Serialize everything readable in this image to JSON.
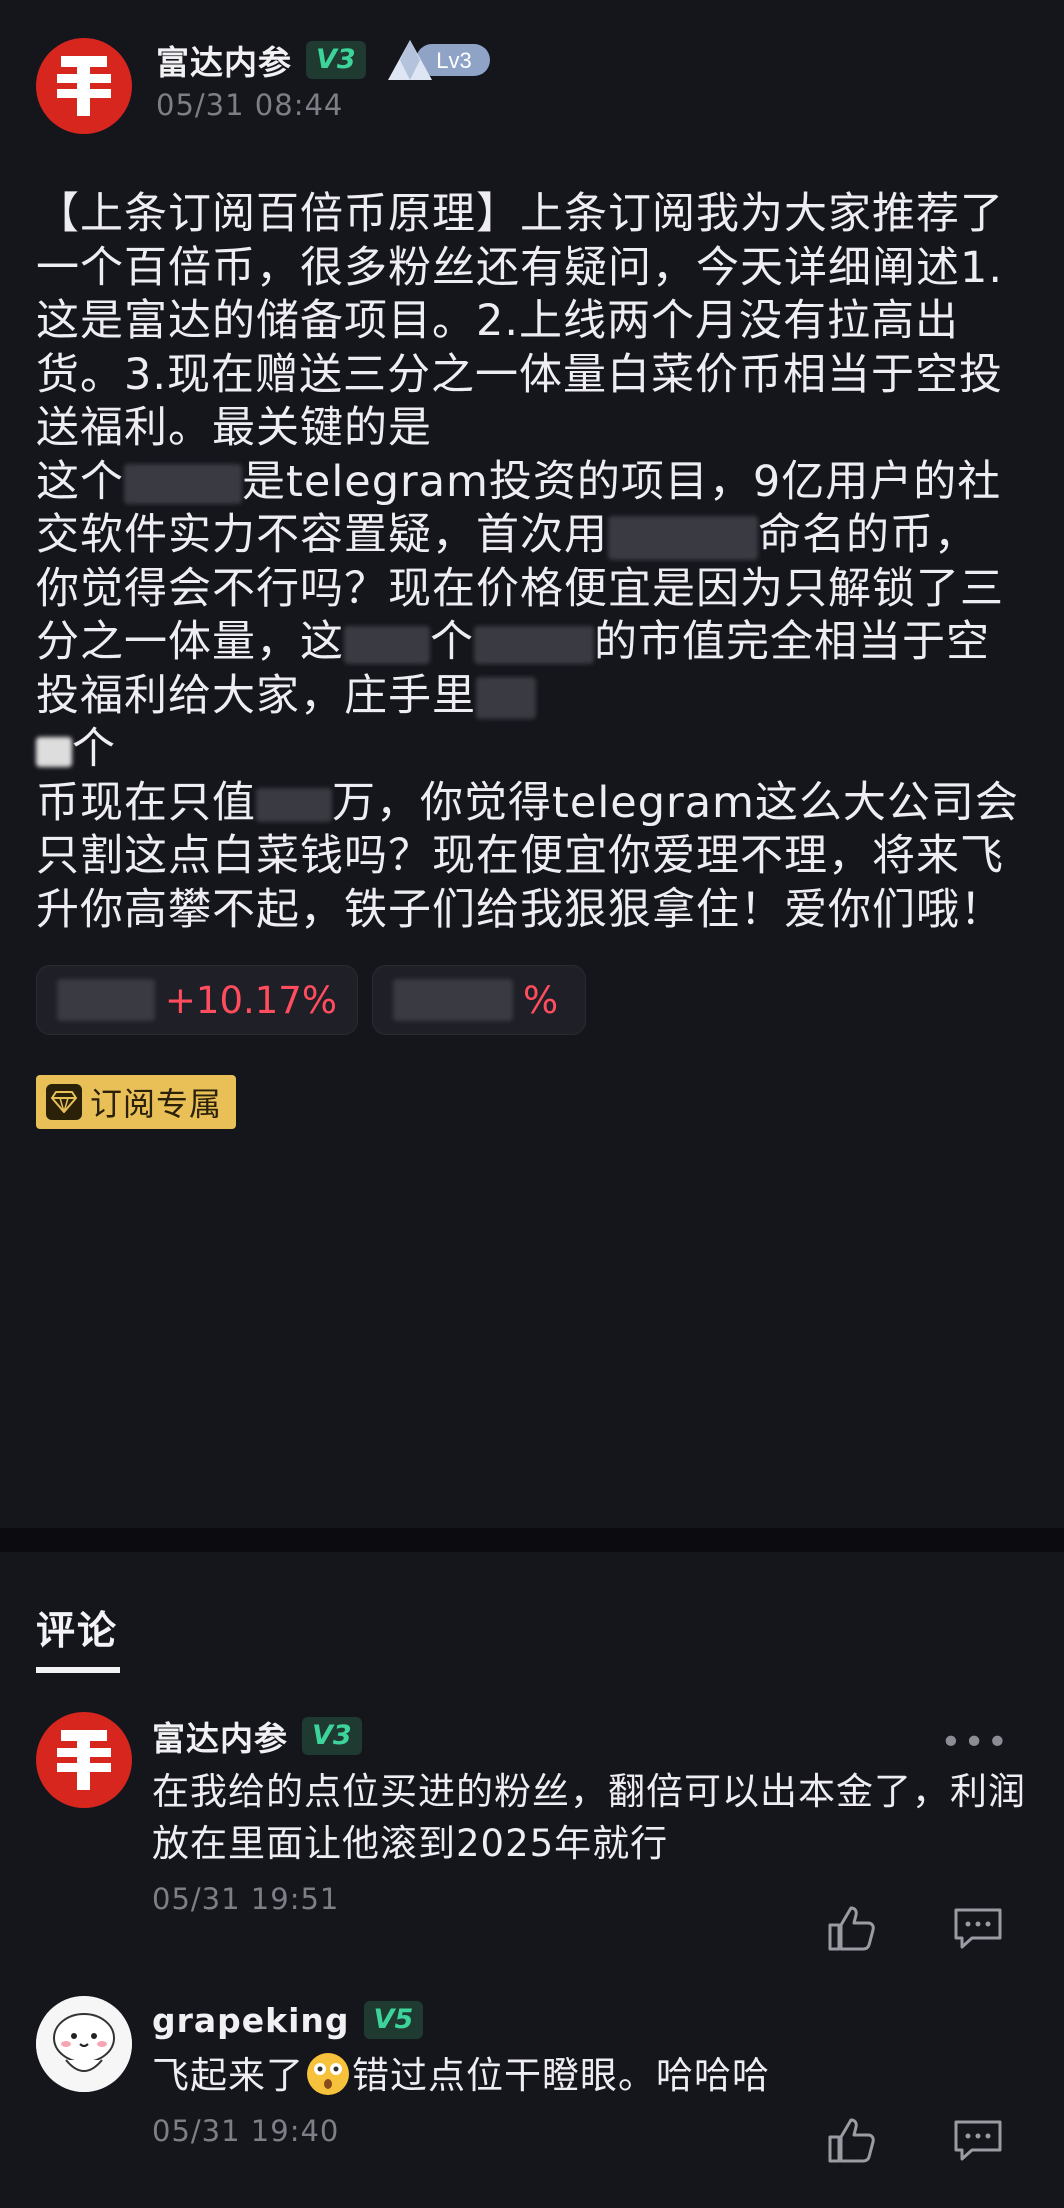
{
  "post": {
    "author": "富达内参",
    "vip_badge": "V3",
    "level_badge": "Lv3",
    "timestamp": "05/31 08:44",
    "content_1": "【上条订阅百倍币原理】上条订阅我为大家推荐了一个百倍币，很多粉丝还有疑问，今天详细阐述1.这是富达的储备项目。2.上线两个月没有拉高出货。3.现在赠送三分之一体量白菜价币相当于空投送福利。最关键的是",
    "content_2a": "这个",
    "content_2b": "是telegram投资的项目，9亿用户的社交软件实力不容置疑，首次用",
    "content_3a": "命名的币，你觉得会不行吗？现在价格便宜是因为只解锁了三分之一体量，这",
    "content_3b": "个",
    "content_3c": "的市值完全相当于空投福利给大家，庄手里",
    "content_4": "个",
    "content_5a": "币现在只值",
    "content_5b": "万，你觉得telegram这么大公司会只割这点白菜钱吗？现在便宜你爱理不理，将来飞升你高攀不起，铁子们给我狠狠拿住！爱你们哦！",
    "stocks": [
      {
        "change": "+10.17%"
      },
      {
        "change": "%"
      }
    ],
    "subscription_tag": "订阅专属"
  },
  "comments_section": {
    "title": "评论",
    "items": [
      {
        "author": "富达内参",
        "badge": "V3",
        "text": "在我给的点位买进的粉丝，翻倍可以出本金了，利润放在里面让他滚到2025年就行",
        "time": "05/31 19:51",
        "more": "•••"
      },
      {
        "author": "grapeking",
        "badge": "V5",
        "text_a": "飞起来了",
        "text_b": "错过点位干瞪眼。哈哈哈",
        "time": "05/31 19:40"
      }
    ]
  },
  "colors": {
    "background": "#15151c",
    "accent_green": "#3cd49a",
    "rise_red": "#ff4d5e",
    "subscription_gold": "#e9bf58",
    "logo_red": "#d7261e"
  }
}
